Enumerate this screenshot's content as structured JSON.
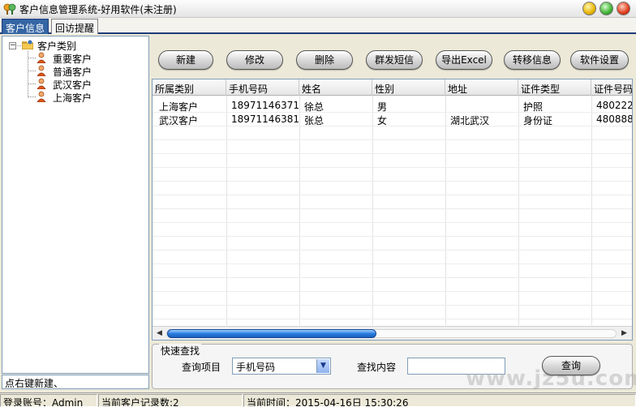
{
  "window": {
    "title": "客户信息管理系统-好用软件(未注册)",
    "icon": "app-icon"
  },
  "tabs": [
    {
      "label": "客户信息",
      "active": true
    },
    {
      "label": "回访提醒",
      "active": false
    }
  ],
  "tree": {
    "root_label": "客户类别",
    "expander": "−",
    "items": [
      {
        "label": "重要客户",
        "icon": "person-icon"
      },
      {
        "label": "普通客户",
        "icon": "person-icon"
      },
      {
        "label": "武汉客户",
        "icon": "person-icon"
      },
      {
        "label": "上海客户",
        "icon": "person-icon"
      }
    ]
  },
  "left_status": "点右键新建、",
  "toolbar": {
    "new": "新建",
    "edit": "修改",
    "delete": "删除",
    "sms": "群发短信",
    "export": "导出Excel",
    "transfer": "转移信息",
    "settings": "软件设置"
  },
  "grid": {
    "columns": [
      "所属类别",
      "手机号码",
      "姓名",
      "性别",
      "地址",
      "证件类型",
      "证件号码"
    ],
    "rows": [
      [
        "上海客户",
        "18971146371",
        "徐总",
        "男",
        "",
        "护照",
        "480222"
      ],
      [
        "武汉客户",
        "18971146381",
        "张总",
        "女",
        "湖北武汉",
        "身份证",
        "480888"
      ]
    ]
  },
  "search": {
    "legend": "快速查找",
    "field_label": "查询项目",
    "field_value": "手机号码",
    "content_label": "查找内容",
    "content_value": "",
    "button": "查询"
  },
  "watermark": "www.jz5u.com",
  "statusbar": {
    "account": "登录账号：Admin",
    "record_count": "当前客户记录数:2",
    "current_time": "当前时间：2015-04-16日 15:30:26"
  },
  "colors": {
    "accent": "#3465a4",
    "scroll_thumb": "#2a7de0"
  }
}
